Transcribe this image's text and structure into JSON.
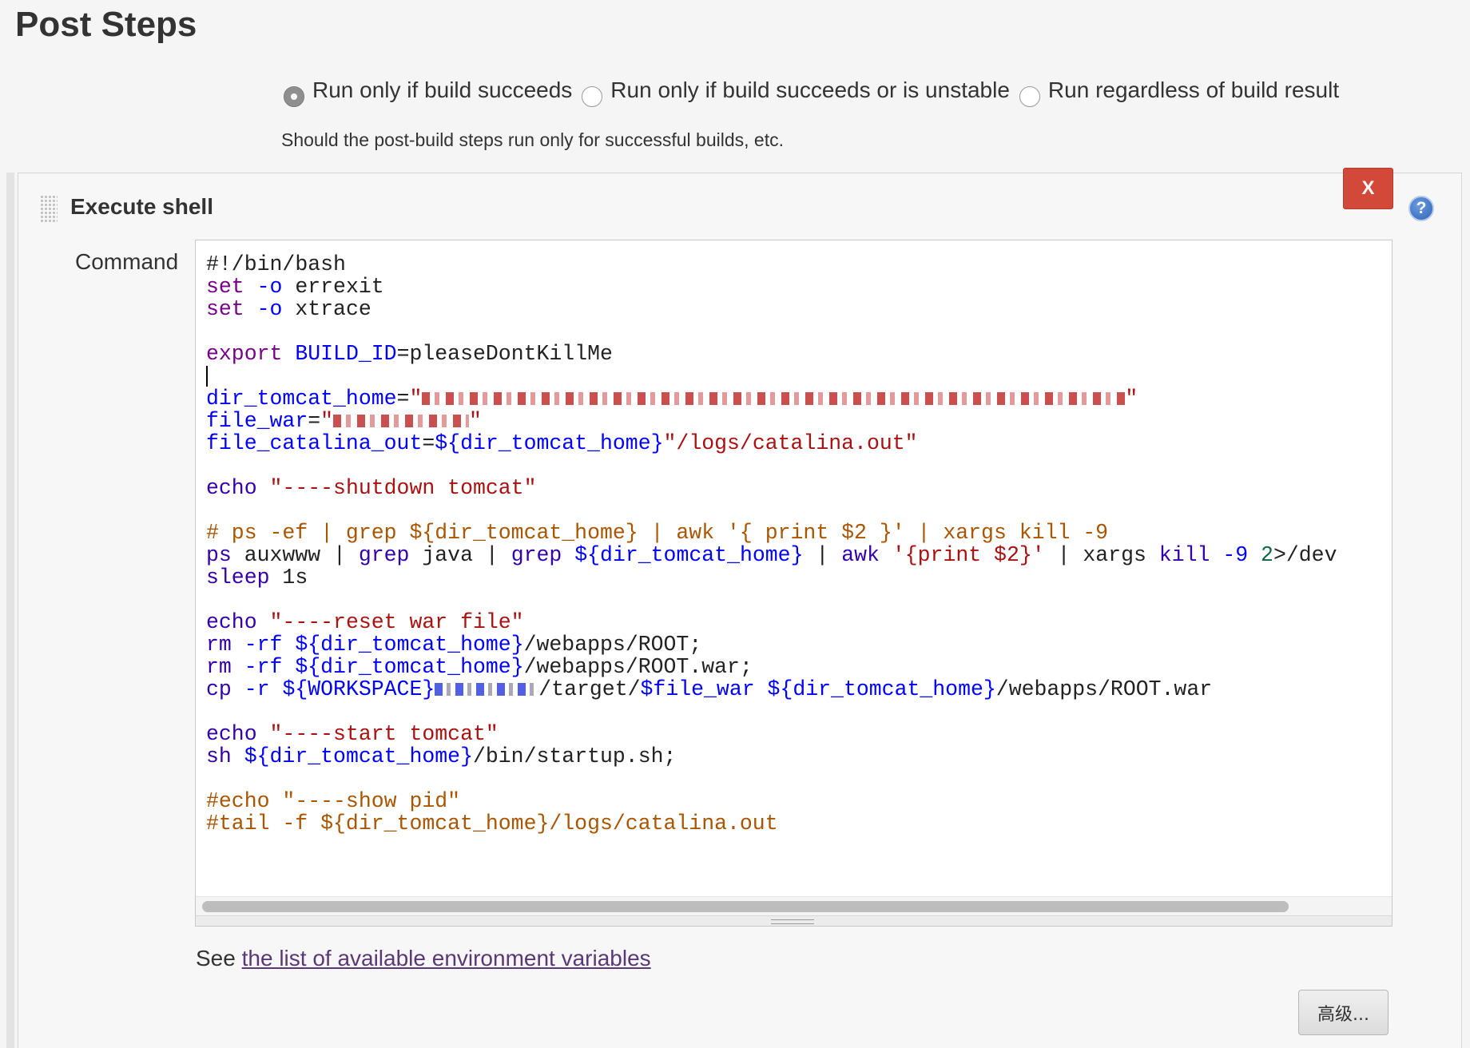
{
  "page_title": "Post Steps",
  "run_options": [
    {
      "label": "Run only if build succeeds",
      "checked": true
    },
    {
      "label": "Run only if build succeeds or is unstable",
      "checked": false
    },
    {
      "label": "Run regardless of build result",
      "checked": false
    }
  ],
  "run_help": "Should the post-build steps run only for successful builds, etc.",
  "step": {
    "title": "Execute shell",
    "delete_label": "X",
    "help_label": "?",
    "command_label": "Command",
    "code": {
      "l1": "#!/bin/bash",
      "l2_kw": "set",
      "l2_opt": "-o",
      "l2_val": "errexit",
      "l3_kw": "set",
      "l3_opt": "-o",
      "l3_val": "xtrace",
      "l5_kw": "export",
      "l5_var": "BUILD_ID",
      "l5_eq": "=",
      "l5_val": "pleaseDontKillMe",
      "l7_var": "dir_tomcat_home",
      "l7_eq": "=",
      "l7_q1": "\"",
      "l7_q2": "\"",
      "l8_var": "file_war",
      "l8_eq": "=",
      "l8_q1": "\"",
      "l8_q2": "\"",
      "l9_var": "file_catalina_out",
      "l9_eq": "=",
      "l9_ref": "${dir_tomcat_home}",
      "l9_str": "\"/logs/catalina.out\"",
      "l11_kw": "echo",
      "l11_str": "\"----shutdown tomcat\"",
      "l13": "# ps -ef | grep ${dir_tomcat_home} | awk '{ print $2 }' | xargs kill -9",
      "l14_a": "ps",
      "l14_b": " auxwww | ",
      "l14_c": "grep",
      "l14_d": " java | ",
      "l14_e": "grep",
      "l14_f": " ",
      "l14_g": "${dir_tomcat_home}",
      "l14_h": " | ",
      "l14_i": "awk",
      "l14_j": " ",
      "l14_k": "'{print $2}'",
      "l14_l": " | xargs ",
      "l14_m": "kill",
      "l14_n": " ",
      "l14_o": "-9",
      "l14_p": " ",
      "l14_q": "2",
      "l14_r": ">/dev",
      "l15_kw": "sleep",
      "l15_val": " 1s",
      "l17_kw": "echo",
      "l17_str": "\"----reset war file\"",
      "l18_cmd": "rm",
      "l18_opt": "-rf",
      "l18_ref": "${dir_tomcat_home}",
      "l18_rest": "/webapps/ROOT;",
      "l19_cmd": "rm",
      "l19_opt": "-rf",
      "l19_ref": "${dir_tomcat_home}",
      "l19_rest": "/webapps/ROOT.war;",
      "l20_cmd": "cp",
      "l20_opt": "-r",
      "l20_ref": "${WORKSPACE}",
      "l20_mid": "/target/",
      "l20_var": "$file_war",
      "l20_ref2": "${dir_tomcat_home}",
      "l20_rest": "/webapps/ROOT.war",
      "l22_kw": "echo",
      "l22_str": "\"----start tomcat\"",
      "l23_cmd": "sh",
      "l23_ref": "${dir_tomcat_home}",
      "l23_rest": "/bin/startup.sh;",
      "l25": "#echo \"----show pid\"",
      "l26": "#tail -f ${dir_tomcat_home}/logs/catalina.out"
    },
    "env_prefix": "See ",
    "env_link": "the list of available environment variables",
    "advanced_label": "高级..."
  }
}
